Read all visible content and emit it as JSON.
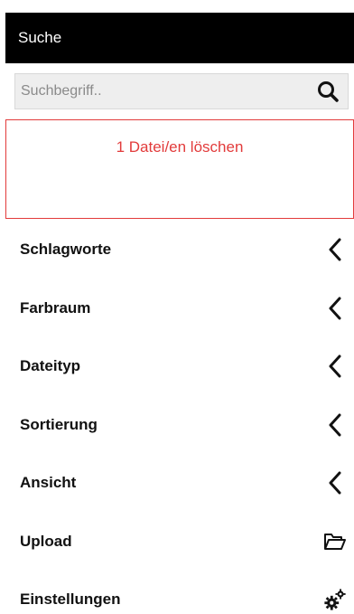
{
  "header": {
    "title": "Suche"
  },
  "search": {
    "placeholder": "Suchbegriff..",
    "button_icon": "search-icon"
  },
  "alert": {
    "text": "1 Datei/en löschen",
    "color": "#e23b3b"
  },
  "menu": {
    "items": [
      {
        "label": "Schlagworte",
        "icon": "chevron-left-icon"
      },
      {
        "label": "Farbraum",
        "icon": "chevron-left-icon"
      },
      {
        "label": "Dateityp",
        "icon": "chevron-left-icon"
      },
      {
        "label": "Sortierung",
        "icon": "chevron-left-icon"
      },
      {
        "label": "Ansicht",
        "icon": "chevron-left-icon"
      },
      {
        "label": "Upload",
        "icon": "folder-open-icon"
      },
      {
        "label": "Einstellungen",
        "icon": "gears-icon"
      }
    ]
  }
}
